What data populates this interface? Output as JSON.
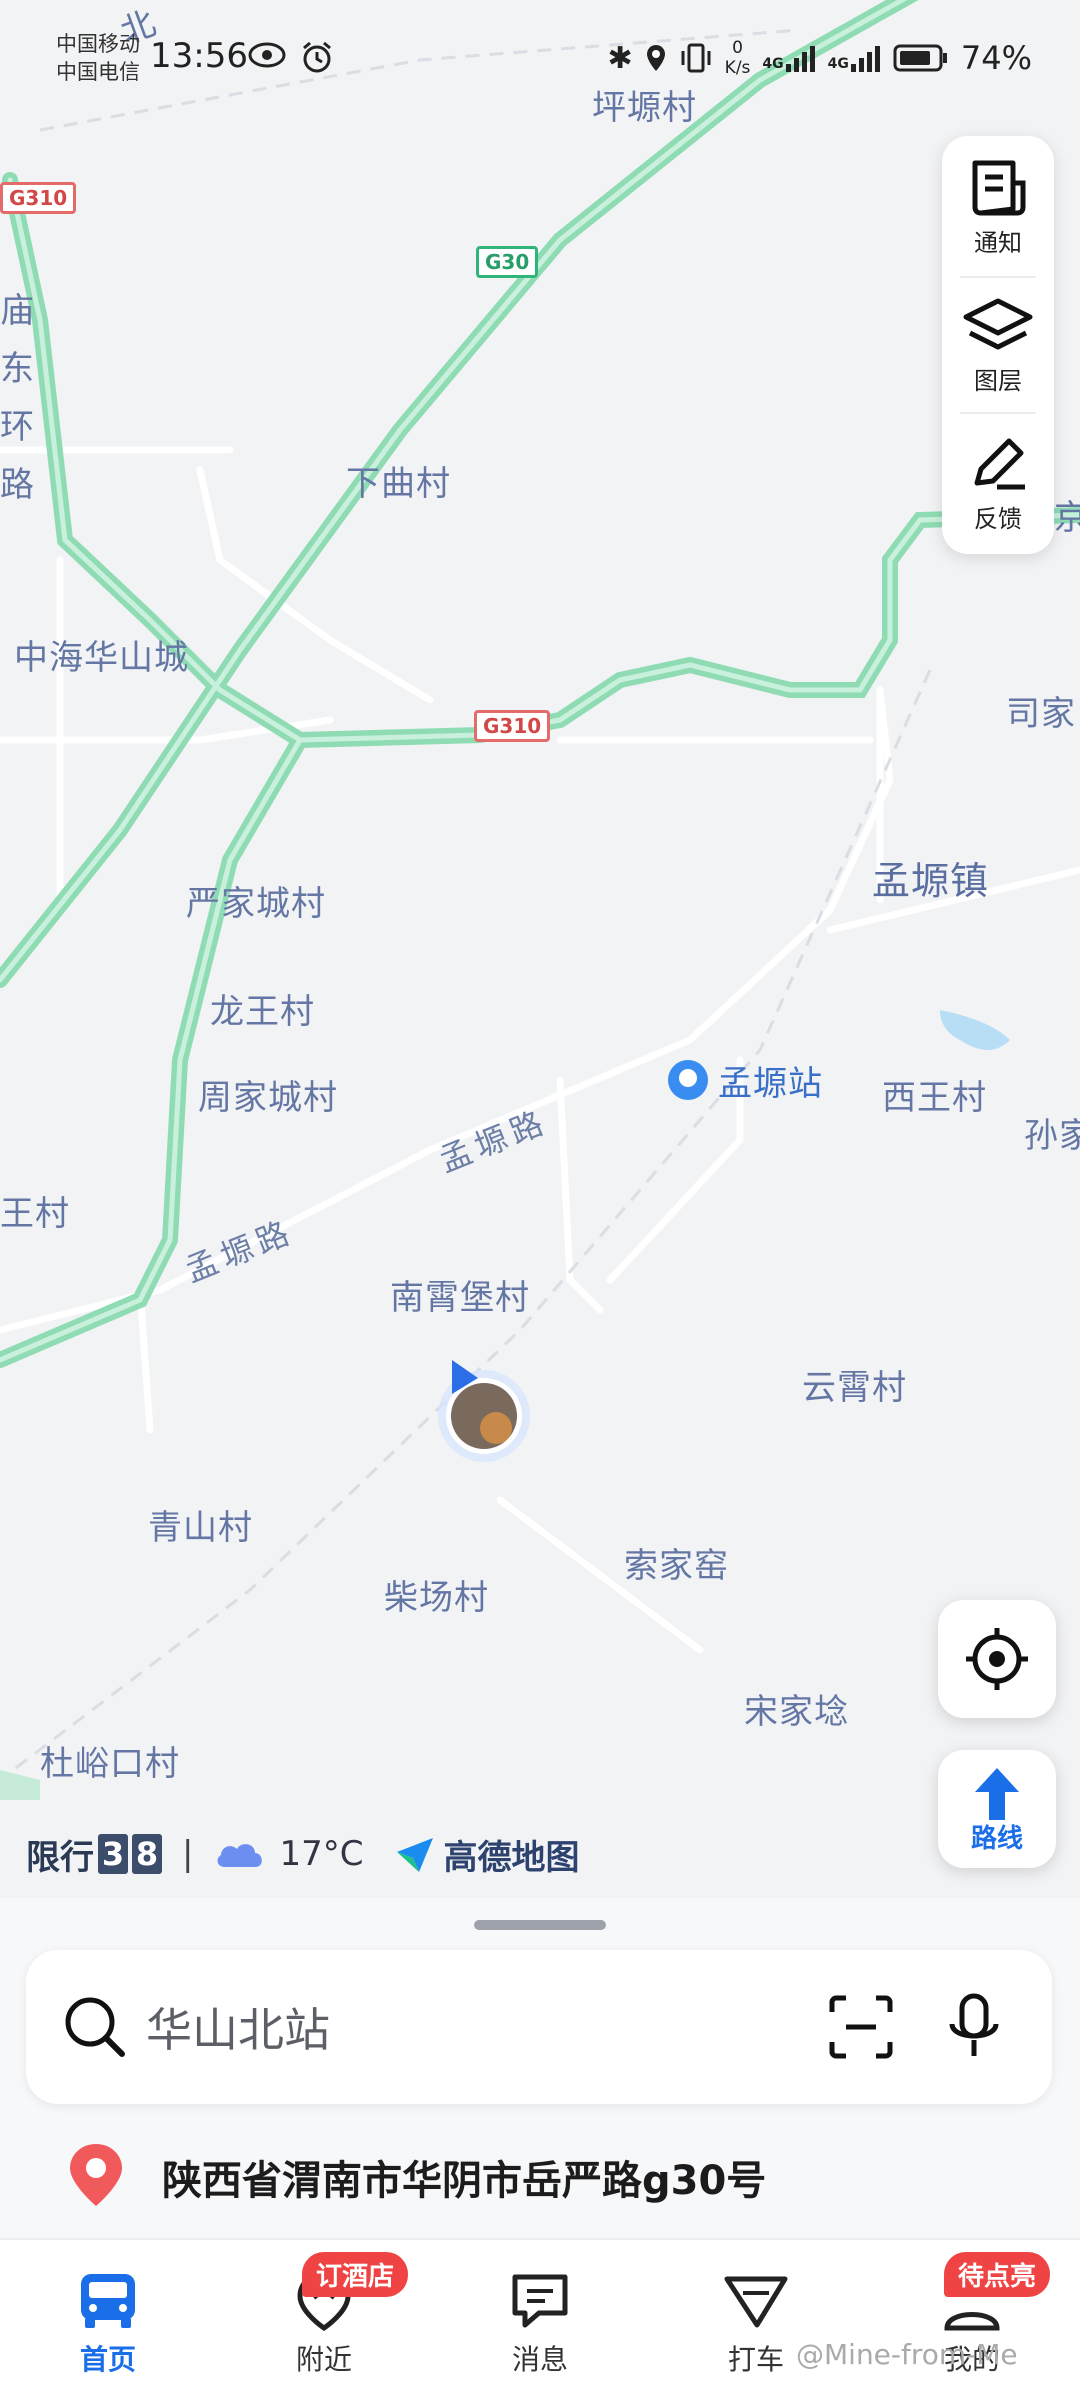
{
  "status_bar": {
    "carrier_1": "中国移动",
    "carrier_2": "中国电信",
    "time": "13:56",
    "net_speed_value": "0",
    "net_speed_unit": "K/s",
    "signal_1": "4G",
    "signal_2": "4G",
    "battery": "74%"
  },
  "map": {
    "place_labels": [
      "坪塬村",
      "下曲村",
      "中海华山城",
      "严家城村",
      "龙王村",
      "周家城村",
      "王村",
      "孟塬镇",
      "西王村",
      "孙家",
      "司家",
      "南霄堡村",
      "云霄村",
      "青山村",
      "柴场村",
      "索家窑",
      "宋家埝",
      "杜峪口村",
      "北",
      "庙东环路",
      "京"
    ],
    "station_label": "孟塬站",
    "road_labels": [
      "孟塬路",
      "孟塬路"
    ],
    "shields": [
      "G310",
      "G30",
      "G310"
    ]
  },
  "map_tools": {
    "notice_label": "通知",
    "layers_label": "图层",
    "feedback_label": "反馈"
  },
  "route_button": {
    "label": "路线"
  },
  "info_strip": {
    "restriction_label": "限行",
    "restriction_digit_1": "3",
    "restriction_digit_2": "8",
    "separator": "|",
    "temperature": "17°C",
    "brand_name": "高德地图"
  },
  "search": {
    "placeholder": "华山北站"
  },
  "current_address": "陕西省渭南市华阴市岳严路g30号",
  "bottom_nav": [
    {
      "label": "首页",
      "active": true
    },
    {
      "label": "附近",
      "badge": "订酒店"
    },
    {
      "label": "消息"
    },
    {
      "label": "打车"
    },
    {
      "label": "我的",
      "badge": "待点亮"
    }
  ],
  "watermark": "@Mine-from-Me",
  "colors": {
    "accent": "#1a6ee8",
    "highway": "#8fdcb4",
    "badge": "#f04444",
    "map_bg": "#f2f3f5"
  }
}
